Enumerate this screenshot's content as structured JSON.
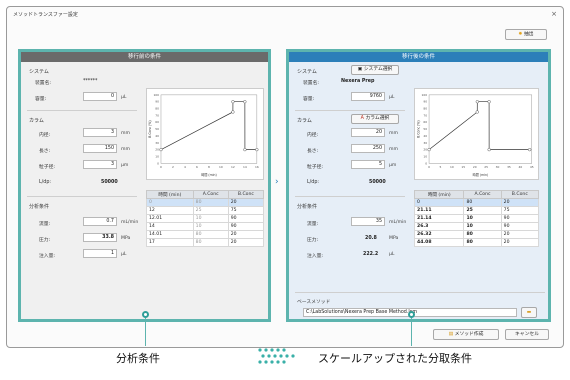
{
  "window": {
    "title": "メソッドトランスファー設定",
    "close": "×"
  },
  "toolbar": {
    "export_label": "抽出"
  },
  "left": {
    "header": "移行前の条件",
    "system": {
      "section": "システム",
      "name_label": "装置名:",
      "name_value": "******",
      "volume_label": "容量:",
      "volume_value": "0",
      "volume_unit": "μL"
    },
    "column": {
      "section": "カラム",
      "id_label": "内径:",
      "id_value": "3",
      "id_unit": "mm",
      "len_label": "長さ:",
      "len_value": "150",
      "len_unit": "mm",
      "particle_label": "粒子径:",
      "particle_value": "3",
      "particle_unit": "μm",
      "ldp_label": "L/dp:",
      "ldp_value": "50000"
    },
    "analysis": {
      "section": "分析条件",
      "flow_label": "流量:",
      "flow_value": "0.7",
      "flow_unit": "mL/min",
      "pressure_label": "圧力:",
      "pressure_value": "33.8",
      "pressure_unit": "MPa",
      "inj_label": "注入量:",
      "inj_value": "1",
      "inj_unit": "μL"
    },
    "table": {
      "headers": [
        "時間 (min)",
        "A.Conc",
        "B.Conc"
      ],
      "rows": [
        [
          "0",
          "80",
          "20"
        ],
        [
          "12",
          "25",
          "75"
        ],
        [
          "12.01",
          "10",
          "90"
        ],
        [
          "14",
          "10",
          "90"
        ],
        [
          "14.01",
          "80",
          "20"
        ],
        [
          "17",
          "80",
          "20"
        ]
      ]
    }
  },
  "right": {
    "header": "移行後の条件",
    "system": {
      "section": "システム",
      "select_label": "システム選択",
      "name_label": "装置名:",
      "name_value": "Nexera Prep",
      "volume_label": "容量:",
      "volume_value": "9760",
      "volume_unit": "μL"
    },
    "column": {
      "section": "カラム",
      "select_label": "カラム選択",
      "id_label": "内径:",
      "id_value": "20",
      "id_unit": "mm",
      "len_label": "長さ:",
      "len_value": "250",
      "len_unit": "mm",
      "particle_label": "粒子径:",
      "particle_value": "5",
      "particle_unit": "μm",
      "ldp_label": "L/dp:",
      "ldp_value": "50000"
    },
    "analysis": {
      "section": "分析条件",
      "flow_label": "流量:",
      "flow_value": "35",
      "flow_unit": "mL/min",
      "pressure_label": "圧力:",
      "pressure_value": "20.8",
      "pressure_unit": "MPa",
      "inj_label": "注入量:",
      "inj_value": "222.2",
      "inj_unit": "μL"
    },
    "table": {
      "headers": [
        "時間 (min)",
        "A.Conc",
        "B.Conc"
      ],
      "rows": [
        [
          "0",
          "80",
          "20"
        ],
        [
          "21.11",
          "25",
          "75"
        ],
        [
          "21.14",
          "10",
          "90"
        ],
        [
          "26.3",
          "10",
          "90"
        ],
        [
          "26.32",
          "80",
          "20"
        ],
        [
          "44.08",
          "80",
          "20"
        ]
      ]
    },
    "base_method": {
      "label": "ベースメソッド",
      "path": "C:\\LabSolutions\\Nexera Prep Base Method.lcm"
    }
  },
  "footer": {
    "method_create_label": "メソッド作成",
    "cancel_label": "キャンセル"
  },
  "captions": {
    "left": "分析条件",
    "right": "スケールアップされた分取条件"
  },
  "chart_data": [
    {
      "type": "line",
      "x": [
        0,
        12,
        12.01,
        14,
        14.01,
        17
      ],
      "y": [
        20,
        75,
        90,
        90,
        20,
        20
      ],
      "xlabel": "時間 (min)",
      "ylabel": "B.Conc (%)",
      "xlim": [
        0,
        16
      ],
      "ylim": [
        0,
        100
      ],
      "xticks": [
        0,
        2,
        4,
        6,
        8,
        10,
        12,
        14,
        16
      ],
      "yticks": [
        0,
        10,
        20,
        30,
        40,
        50,
        60,
        70,
        80,
        90,
        100
      ]
    },
    {
      "type": "line",
      "x": [
        0,
        21.11,
        21.14,
        26.3,
        26.32,
        44.08
      ],
      "y": [
        20,
        75,
        90,
        90,
        20,
        20
      ],
      "xlabel": "時間 (min)",
      "ylabel": "B.Conc (%)",
      "xlim": [
        0,
        45
      ],
      "ylim": [
        0,
        100
      ],
      "xticks": [
        0,
        5,
        10,
        15,
        20,
        25,
        30,
        35,
        40,
        45
      ],
      "yticks": [
        0,
        10,
        20,
        30,
        40,
        50,
        60,
        70,
        80,
        90,
        100
      ]
    }
  ]
}
